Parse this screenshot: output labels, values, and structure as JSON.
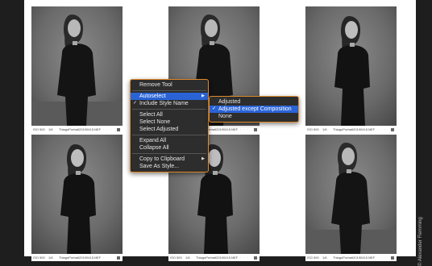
{
  "thumbnails": [
    {
      "iso": "ISO 500",
      "exposure": "1/6",
      "filename": "ThiagoPortrait20190415.NEF",
      "rating_dots": "· · · · ·"
    },
    {
      "iso": "ISO 500",
      "exposure": "1/6",
      "filename": "ThiagoPortrait20190415.NEF",
      "rating_dots": "· · · · ·"
    },
    {
      "iso": "ISO 500",
      "exposure": "1/6",
      "filename": "ThiagoPortrait20190415.NEF",
      "rating_dots": "· · · · ·"
    },
    {
      "iso": "ISO 500",
      "exposure": "1/6",
      "filename": "ThiagoPortrait20190415.NEF",
      "rating_dots": "· · · · ·"
    },
    {
      "iso": "ISO 500",
      "exposure": "1/6",
      "filename": "ThiagoPortrait20190415.NEF",
      "rating_dots": "· · · · ·"
    },
    {
      "iso": "ISO 500",
      "exposure": "1/6",
      "filename": "ThiagoPortrait20190415.NEF",
      "rating_dots": "· · · · ·"
    }
  ],
  "context_menu": {
    "remove_tool": "Remove Tool",
    "autoselect": "Autoselect",
    "include_style_name": "Include Style Name",
    "select_all": "Select All",
    "select_none": "Select None",
    "select_adjusted": "Select Adjusted",
    "expand_all": "Expand All",
    "collapse_all": "Collapse All",
    "copy_to_clipboard": "Copy to Clipboard",
    "save_as_style": "Save As Style..."
  },
  "submenu": {
    "adjusted": "Adjusted",
    "adjusted_except_composition": "Adjusted except Composition",
    "none": "None"
  },
  "colors": {
    "menu_bg": "#2d2d2d",
    "menu_border": "#e08a2b",
    "highlight": "#2a63d6",
    "background": "#1e1e1e"
  },
  "credit": "© Alexander Flemming"
}
